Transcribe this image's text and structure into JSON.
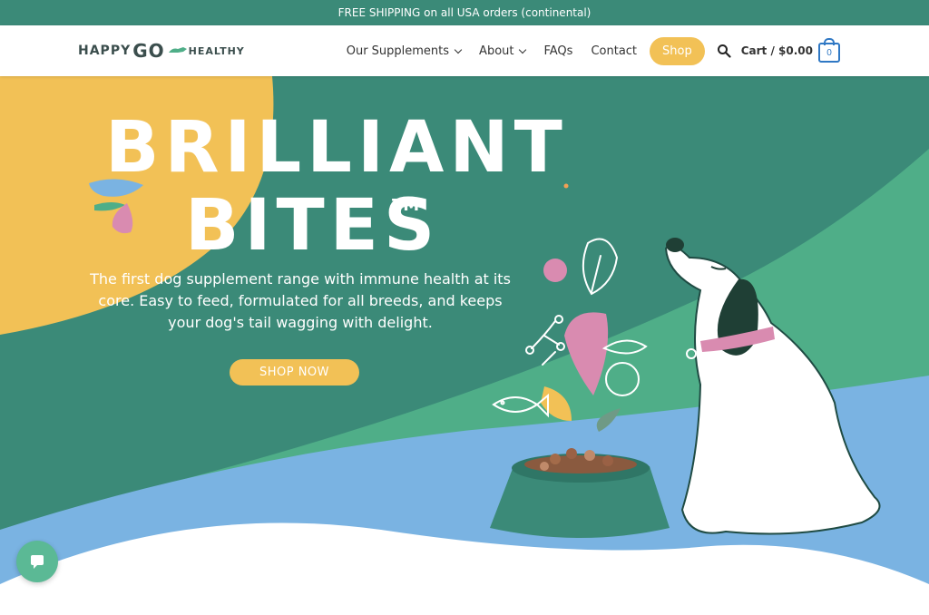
{
  "announcement": {
    "text": "FREE SHIPPING on all USA orders (continental)"
  },
  "logo": {
    "happy": "HAPPY",
    "go": "GO",
    "healthy": "HEALTHY"
  },
  "nav": {
    "items": [
      {
        "label": "Our Supplements",
        "has_dropdown": true
      },
      {
        "label": "About",
        "has_dropdown": true
      },
      {
        "label": "FAQs",
        "has_dropdown": false
      },
      {
        "label": "Contact",
        "has_dropdown": false
      }
    ],
    "shop_label": "Shop",
    "search_icon": "search-icon",
    "cart_label": "Cart / $0.00",
    "cart_count": "0"
  },
  "hero": {
    "headline_line1": "BRILLIANT",
    "headline_line2": "BITES",
    "trademark": "TM",
    "subtitle": "The first dog supplement range with immune health at its core. Easy to feed, formulated for all breeds, and keeps your dog's tail wagging with delight.",
    "cta_label": "SHOP NOW"
  },
  "chat": {
    "icon": "chat-bubble-icon"
  },
  "colors": {
    "teal_dark": "#3b8a78",
    "teal_light": "#4fae88",
    "yellow": "#f2c156",
    "blue": "#7ab3e2",
    "pink": "#d98bb0",
    "cart_blue": "#2f78c4"
  }
}
